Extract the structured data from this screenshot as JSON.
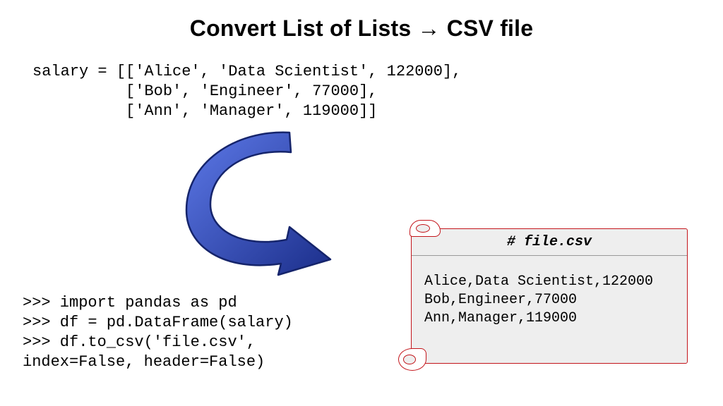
{
  "title": "Convert List of Lists → CSV file",
  "code_top": "salary = [['Alice', 'Data Scientist', 122000],\n          ['Bob', 'Engineer', 77000],\n          ['Ann', 'Manager', 119000]]",
  "code_bottom": ">>> import pandas as pd\n>>> df = pd.DataFrame(salary)\n>>> df.to_csv('file.csv',\nindex=False, header=False)",
  "file": {
    "label": "# file.csv",
    "content": "Alice,Data Scientist,122000\nBob,Engineer,77000\nAnn,Manager,119000"
  },
  "arrow_color_outer": "#1b2e8a",
  "arrow_color_inner": "#3f5bd9"
}
